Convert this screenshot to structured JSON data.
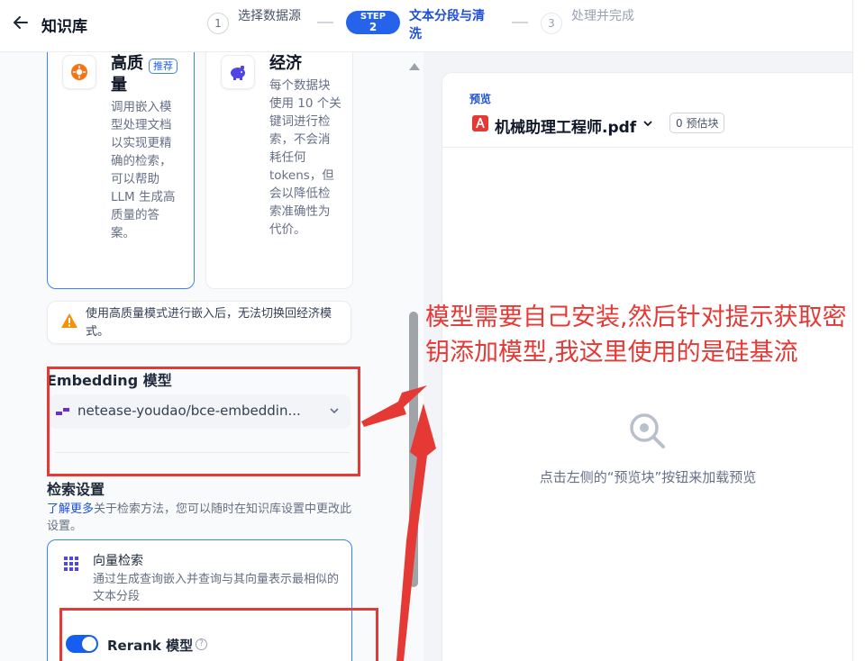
{
  "header": {
    "back_label": "知识库",
    "steps": [
      {
        "num": "1",
        "label": "选择数据源",
        "state": "done"
      },
      {
        "num": "2",
        "step_tag": "STEP",
        "label": "文本分段与清洗",
        "state": "active"
      },
      {
        "num": "3",
        "label": "处理并完成",
        "state": "disabled"
      }
    ]
  },
  "index_mode": {
    "high_quality": {
      "title": "高质量",
      "badge": "推荐",
      "desc": "调用嵌入模型处理文档以实现更精确的检索，可以帮助 LLM 生成高质量的答案。"
    },
    "economy": {
      "title": "经济",
      "desc": "每个数据块使用 10 个关键词进行检索，不会消耗任何 tokens，但会以降低检索准确性为代价。"
    },
    "warning": "使用高质量模式进行嵌入后，无法切换回经济模式。"
  },
  "embedding": {
    "title": "Embedding 模型",
    "model": "netease-youdao/bce-embeddin..."
  },
  "retrieval": {
    "title": "检索设置",
    "learn_more": "了解更多",
    "desc": "关于检索方法，您可以随时在知识库设置中更改此设置。",
    "vector": {
      "title": "向量检索",
      "desc": "通过生成查询嵌入并查询与其向量表示最相似的文本分段"
    },
    "rerank_label": "Rerank 模型",
    "rerank_on": true
  },
  "preview": {
    "label": "预览",
    "file_name": "机械助理工程师.pdf",
    "chunk_badge": "0 预估块",
    "empty_text": "点击左侧的“预览块”按钮来加载预览"
  },
  "annotation": {
    "note": "模型需要自己安装,然后针对提示获取密钥添加模型,我这里使用的是硅基流",
    "color": "#e53935"
  },
  "colors": {
    "accent": "#2563eb",
    "annotation": "#e53935",
    "warning": "#f79009"
  }
}
